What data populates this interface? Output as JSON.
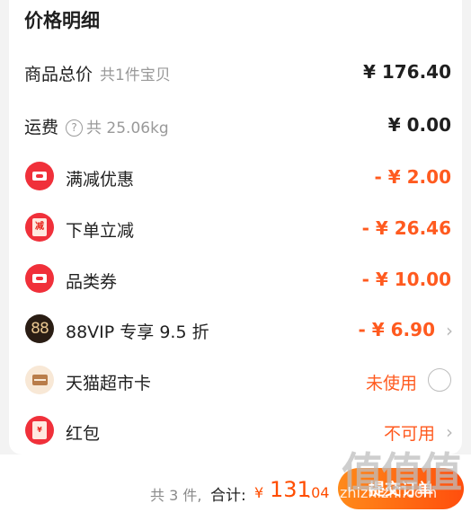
{
  "section_title": "价格明细",
  "goods_total": {
    "label": "商品总价",
    "sub": "共1件宝贝",
    "value": "¥ 176.40"
  },
  "shipping": {
    "label": "运费",
    "help": "?",
    "sub": "共 25.06kg",
    "value": "¥ 0.00"
  },
  "discounts": [
    {
      "label": "满减优惠",
      "value": "- ¥ 2.00",
      "icon": "ticket-icon"
    },
    {
      "label": "下单立减",
      "value": "- ¥ 26.46",
      "icon": "red-envelope-icon",
      "icon_text": "减"
    },
    {
      "label": "品类券",
      "value": "- ¥ 10.00",
      "icon": "coupon-icon"
    },
    {
      "label": "88VIP 专享 9.5 折",
      "value": "- ¥ 6.90",
      "icon": "vip88-icon",
      "icon_text": "88"
    }
  ],
  "tmall_card": {
    "label": "天猫超市卡",
    "status": "未使用",
    "icon": "card-icon"
  },
  "red_packet": {
    "label": "红包",
    "status": "不可用",
    "icon": "red-packet-icon"
  },
  "footer": {
    "count": "共 3 件,",
    "total_label": "合计:",
    "currency": "¥",
    "amount": "131",
    "cents": ".04",
    "submit_label": "提交订单"
  },
  "watermark": {
    "main": "值值值",
    "sub": "zhizhizhi.com"
  },
  "colors": {
    "accent": "#ff5a1f",
    "text": "#1f1f1f",
    "muted": "#999999",
    "icon_red": "#f0303a"
  }
}
